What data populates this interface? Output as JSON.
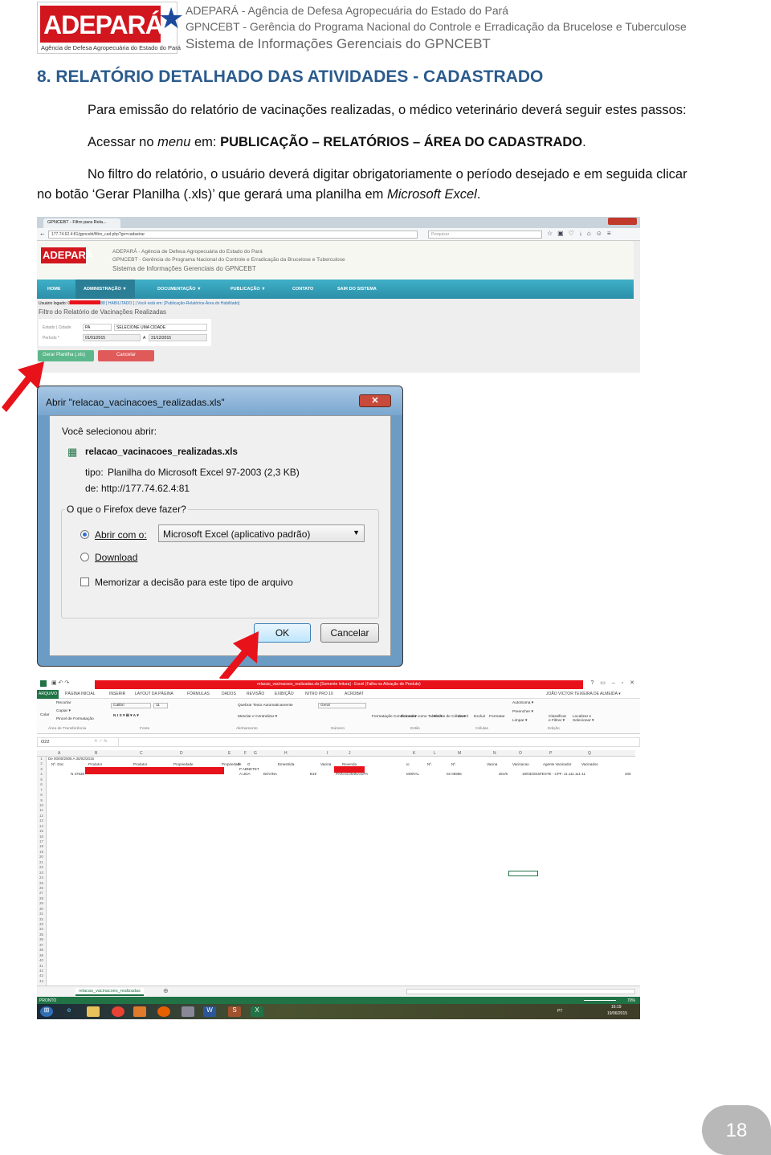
{
  "header": {
    "logo_text": "ADEPARÁ",
    "logo_subtitle": "Agência de Defesa Agropecuária do Estado do Pará",
    "line1": "ADEPARÁ - Agência de Defesa Agropecuária do Estado do Pará",
    "line2": "GPNCEBT - Gerência do Programa Nacional do Controle e Erradicação da Brucelose e Tuberculose",
    "line3": "Sistema de Informações Gerenciais do GPNCEBT"
  },
  "section_title": "8. RELATÓRIO DETALHADO DAS ATIVIDADES - CADASTRADO",
  "paragraphs": {
    "p1": "Para emissão do relatório de vacinações realizadas, o médico veterinário deverá seguir estes passos:",
    "p2_prefix": "Acessar no ",
    "p2_italic": "menu",
    "p2_mid": " em: ",
    "p2_bold": "PUBLICAÇÃO – RELATÓRIOS – ÁREA DO CADASTRADO",
    "p2_end": ".",
    "p3_line1": "No filtro do relatório, o usuário deverá digitar obrigatoriamente o período desejado e em seguida clicar",
    "p3_line2_prefix": "no botão ‘Gerar Planilha (.xls)’ que gerará uma planilha em ",
    "p3_line2_italic": "Microsoft Excel",
    "p3_line2_end": "."
  },
  "browser": {
    "tab_title": "GPNCEBT - Filtro para Rela...",
    "url": "177.74.62.4:81/gpncebt/filtro_cad.php?go=cadastrar",
    "search_placeholder": "Pesquisar",
    "site_logo": "ADEPARÁ",
    "site_line1": "ADEPARÁ - Agência de Defesa Agropecuária do Estado do Pará",
    "site_line2": "GPNCEBT - Gerência do Programa Nacional do Controle e Erradicação da Brucelose e Tuberculose",
    "site_line3": "Sistema de Informações Gerenciais do GPNCEBT",
    "nav": [
      "HOME",
      "ADMINISTRAÇÃO ▼",
      "DOCUMENTAÇÃO ▼",
      "PUBLICAÇÃO ▼",
      "CONTATO",
      "SAIR DO SISTEMA"
    ],
    "user_prefix": "Usuário logado: 0",
    "user_suffix": "88 [ HABILITADO ] | Você está em: [Publicação-Relatórios-Área do Habilitado]",
    "filter_title": "Filtro do Relatório de Vacinações Realizadas",
    "estado_label": "Estado | Cidade",
    "estado_value": "PA",
    "cidade_value": "SELECIONE UMA CIDADE",
    "periodo_label": "Período *",
    "date_from": "01/01/2015",
    "date_sep": "A",
    "date_to": "31/12/2015",
    "generate_button": "Gerar Planilha (.xls)",
    "cancel_button": "Cancelar",
    "colors": {
      "nav": "#2c8fa8",
      "generate": "#5cb88a",
      "cancel": "#e05a5a"
    }
  },
  "dialog": {
    "title": "Abrir \"relacao_vacinacoes_realizadas.xls\"",
    "selected_label": "Você selecionou abrir:",
    "filename": "relacao_vacinacoes_realizadas.xls",
    "type_label": "tipo:",
    "type_value": "Planilha do Microsoft Excel 97-2003 (2,3 KB)",
    "from_label": "de:",
    "from_value": "http://177.74.62.4:81",
    "question": "O que o Firefox deve fazer?",
    "open_with": "Abrir com o:",
    "open_with_app": "Microsoft Excel (aplicativo padrão)",
    "download": "Download",
    "remember": "Memorizar a decisão para este tipo de arquivo",
    "ok": "OK",
    "cancel": "Cancelar",
    "open_with_selected": true,
    "remember_checked": false
  },
  "excel": {
    "title": "relacao_vacinacoes_realizadas.xls [Somente leitura] - Excel (Falha na Ativação de Produto)",
    "tabs": [
      "ARQUIVO",
      "PÁGINA INICIAL",
      "INSERIR",
      "LAYOUT DA PÁGINA",
      "FÓRMULAS",
      "DADOS",
      "REVISÃO",
      "EXIBIÇÃO",
      "NITRO PRO 10",
      "ACROBAT"
    ],
    "user": "JOÃO VICTOR TEIXEIRA DE ALMEIDA ▾",
    "ribbon": {
      "clipboard": [
        "Recortar",
        "Copiar ▾",
        "Pincel de Formatação",
        "Colar",
        "Área de Transferência"
      ],
      "font_name": "Calibri",
      "font_size": "11",
      "font_group": "Fonte",
      "wrap": "Quebrar Texto Automaticamente",
      "merge": "Mesclar e Centralizar ▾",
      "align_group": "Alinhamento",
      "number_format": "Geral",
      "number_group": "Número",
      "styles": [
        "Formatação Condicional ▾",
        "Formatar como Tabela ▾",
        "Estilos de Célula ▾"
      ],
      "styles_group": "Estilo",
      "cells": [
        "Inserir",
        "Excluir",
        "Formatar"
      ],
      "cells_group": "Células",
      "editing": [
        "AutoSoma ▾",
        "Preencher ▾",
        "Limpar ▾",
        "Classificar e Filtrar ▾",
        "Localizar e Selecionar ▾"
      ],
      "editing_group": "Edição"
    },
    "name_box": "O22",
    "columns": [
      "A",
      "B",
      "C",
      "D",
      "E",
      "F",
      "G",
      "H",
      "I",
      "J",
      "K",
      "L",
      "M",
      "N",
      "O",
      "P",
      "Q"
    ],
    "row1": "De 00/00/2005 A 30/02/2015",
    "row2": [
      "Nº. Doc",
      "Produtor",
      "Produtor",
      "Propriedade",
      "Propriedade",
      "F",
      "G",
      "Emestrida",
      "Vacina",
      "Revenda",
      "io",
      "Nº.",
      "Nº.",
      "Vacina",
      "Vacinacao",
      "Agente Vacinador",
      "Vacinados"
    ],
    "row3": [
      "N 47638",
      "P ABNETET",
      "A UDA",
      "BOVINA",
      "B19",
      "PARAGOMINAS/PA",
      "MORAL",
      "02 06995",
      "dez/6",
      "19/03/2015",
      "TESTE - CPF: 11.111.111-11",
      "400"
    ],
    "row_numbers": [
      "1",
      "2",
      "3",
      "4",
      "5",
      "6",
      "7",
      "8",
      "9",
      "10",
      "11",
      "12",
      "13",
      "14",
      "15",
      "16",
      "17",
      "18",
      "19",
      "20",
      "21",
      "22",
      "23",
      "24",
      "25",
      "26",
      "27",
      "28",
      "29",
      "30",
      "31",
      "32",
      "33",
      "34",
      "35",
      "36",
      "37",
      "38",
      "39",
      "40",
      "41",
      "42",
      "43",
      "44"
    ],
    "sheet_tab": "relacao_vacinacoes_realizadas",
    "status": "PRONTO",
    "zoom": "70%",
    "clock_time": "16:19",
    "clock_date": "19/06/2015",
    "lang": "PT",
    "title_bar_color": "#e8121b",
    "status_color": "#217346"
  },
  "page_number": "18"
}
